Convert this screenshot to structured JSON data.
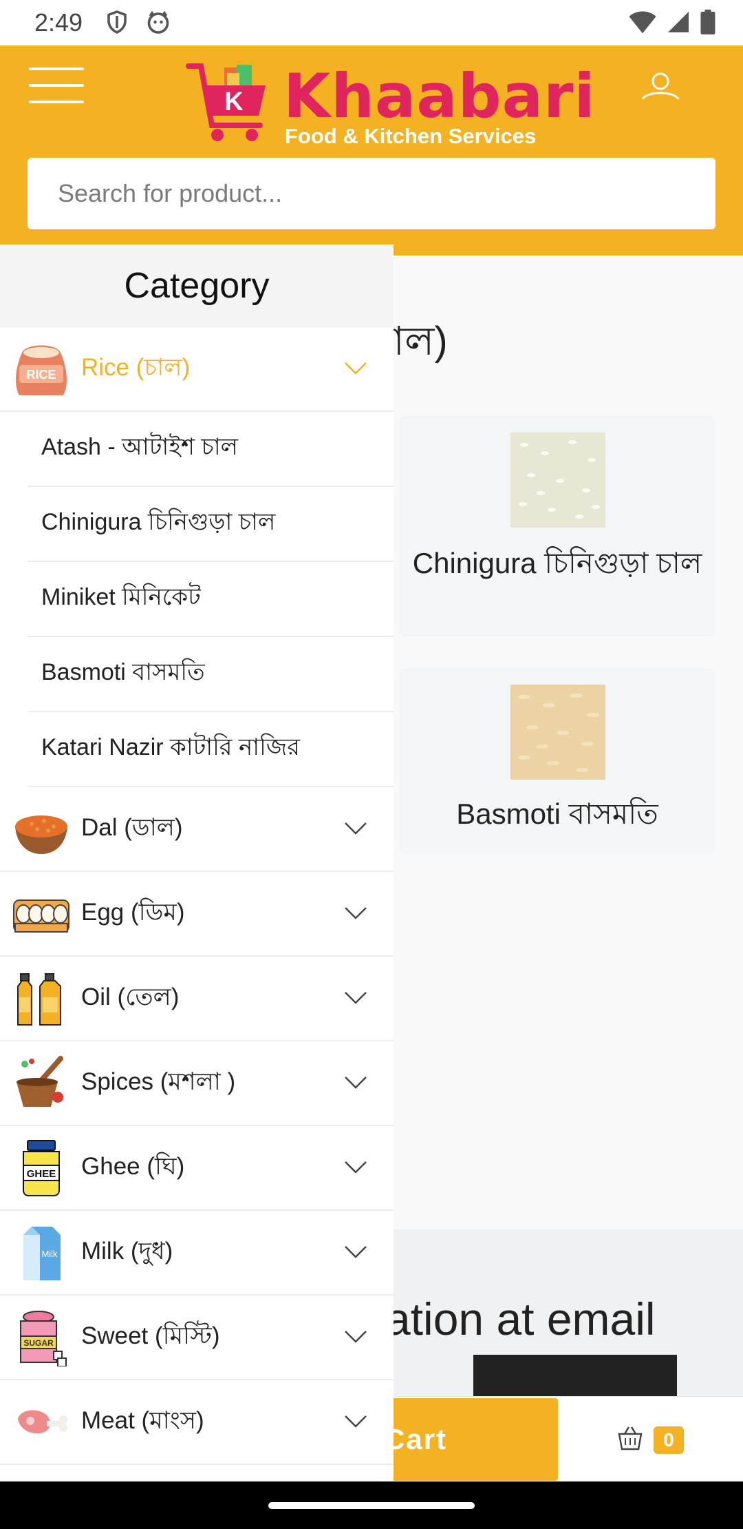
{
  "status_bar": {
    "time": "2:49"
  },
  "header": {
    "brand_title": "Khaabari",
    "brand_tagline": "Food & Kitchen Services",
    "logo_letter": "K",
    "search_placeholder": "Search for product..."
  },
  "background_page": {
    "title_fragment": "চাল)",
    "subtitle_fragment": "-",
    "products": [
      {
        "name": "Chinigura চিনিগুড়া চাল",
        "swatch": "#e8e6d4"
      },
      {
        "name": "Basmoti বাসমতি",
        "swatch": "#ecd3a4"
      }
    ],
    "newsletter_fragment": "ation at email",
    "cart_button_fragment": "Cart",
    "cart_count": "0"
  },
  "drawer": {
    "heading": "Category",
    "categories": [
      {
        "label": "Rice (চাল)",
        "icon": "rice-bag-icon",
        "active": true,
        "subcategories": [
          "Atash - আটাইশ চাল",
          "Chinigura চিনিগুড়া চাল",
          "Miniket মিনিকেট",
          "Basmoti বাসমতি",
          "Katari Nazir কাটারি নাজির"
        ]
      },
      {
        "label": "Dal (ডাল)",
        "icon": "lentil-bowl-icon"
      },
      {
        "label": "Egg (ডিম)",
        "icon": "egg-tray-icon"
      },
      {
        "label": "Oil (তেল)",
        "icon": "oil-bottles-icon"
      },
      {
        "label": "Spices (মশলা )",
        "icon": "mortar-spices-icon"
      },
      {
        "label": "Ghee (ঘি)",
        "icon": "ghee-jar-icon",
        "icon_text": "GHEE"
      },
      {
        "label": "Milk (দুধ)",
        "icon": "milk-carton-icon",
        "icon_text": "Milk"
      },
      {
        "label": "Sweet (মিস্টি)",
        "icon": "sugar-jar-icon",
        "icon_text": "SUGAR"
      },
      {
        "label": "Meat (মাংস)",
        "icon": "meat-icon"
      }
    ]
  },
  "colors": {
    "brand_yellow": "#f4b223",
    "brand_pink": "#e0245e"
  }
}
